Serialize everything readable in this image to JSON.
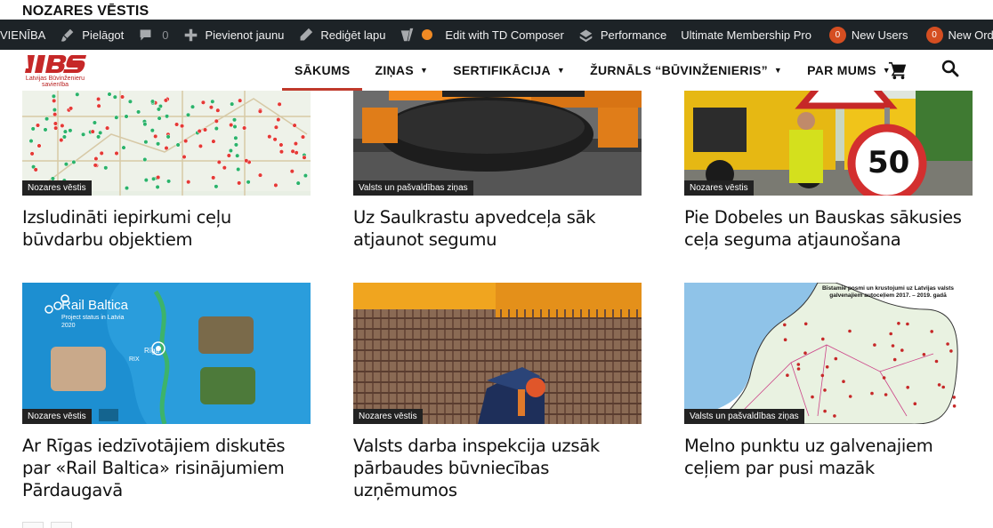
{
  "section_label": "NOZARES VĒSTIS",
  "adminbar": {
    "site_name": "VIENĪBA",
    "customize": "Pielāgot",
    "comments_count": "0",
    "new": "Pievienot jaunu",
    "edit_page": "Rediģēt lapu",
    "td_composer": "Edit with TD Composer",
    "performance": "Performance",
    "ump": "Ultimate Membership Pro",
    "new_users_count": "0",
    "new_users": "New Users",
    "new_orders_count": "0",
    "new_orders": "New Orde"
  },
  "logo": {
    "subtitle": "Latvijas Būvinženieru savienība"
  },
  "nav": {
    "items": [
      {
        "label": "SĀKUMS",
        "active": true,
        "dropdown": false
      },
      {
        "label": "ZIŅAS",
        "active": false,
        "dropdown": true
      },
      {
        "label": "SERTIFIKĀCIJA",
        "active": false,
        "dropdown": true
      },
      {
        "label": "ŽURNĀLS “BŪVINŽENIERIS”",
        "active": false,
        "dropdown": true
      },
      {
        "label": "PAR MUMS",
        "active": false,
        "dropdown": true
      }
    ]
  },
  "cards": [
    {
      "category": "Nozares vēstis",
      "title": "Izsludināti iepirkumi ceļu būvdarbu objektiem"
    },
    {
      "category": "Valsts un pašvaldības ziņas",
      "title": "Uz Saulkrastu apvedceļa sāk atjaunot segumu"
    },
    {
      "category": "Nozares vēstis",
      "title": "Pie Dobeles un Bauskas sākusies ceļa seguma atjaunošana"
    },
    {
      "category": "Nozares vēstis",
      "title": "Ar Rīgas iedzīvotājiem diskutēs par «Rail Baltica» risinājumiem Pārdaugavā"
    },
    {
      "category": "Nozares vēstis",
      "title": "Valsts darba inspekcija uzsāk pārbaudes būvniecības uzņēmumos"
    },
    {
      "category": "Valsts un pašvaldības ziņas",
      "title": "Melno punktu uz galvenajiem ceļiem par pusi mazāk"
    }
  ],
  "image_text": {
    "rail_title": "Rail Baltica",
    "rail_sub1": "Project status in Latvia",
    "rail_sub2": "2020",
    "rail_city": "Rīga",
    "rail_rix": "RIX",
    "sign_speed": "50",
    "map_caption1": "Bīstamie posmi un krustojumi uz Latvijas valsts",
    "map_caption2": "galvenajiem autoceļiem 2017. – 2019. gadā"
  },
  "colors": {
    "accent": "#c0392b",
    "adminbar": "#1d2327"
  }
}
